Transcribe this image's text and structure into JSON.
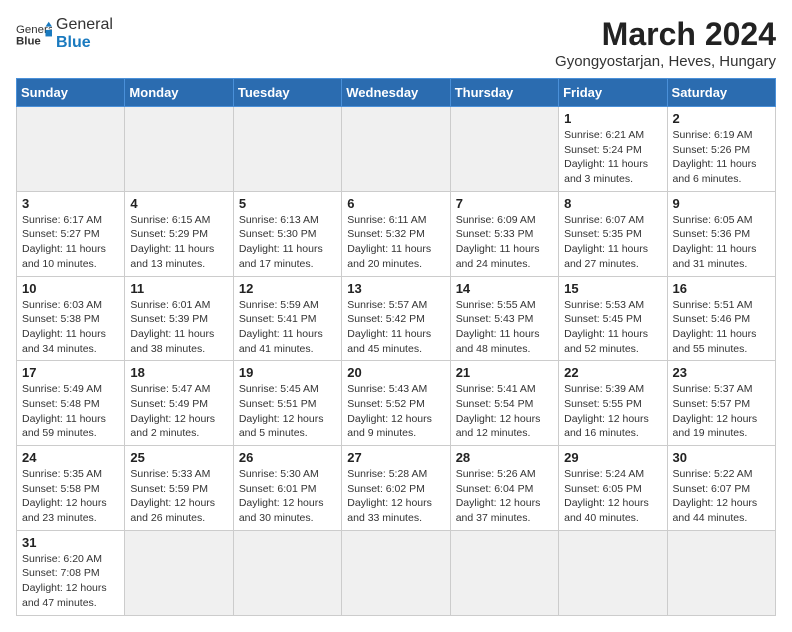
{
  "header": {
    "logo_text_normal": "General",
    "logo_text_bold": "Blue",
    "month_year": "March 2024",
    "location": "Gyongyostarjan, Heves, Hungary"
  },
  "weekdays": [
    "Sunday",
    "Monday",
    "Tuesday",
    "Wednesday",
    "Thursday",
    "Friday",
    "Saturday"
  ],
  "weeks": [
    [
      {
        "day": "",
        "info": "",
        "empty": true
      },
      {
        "day": "",
        "info": "",
        "empty": true
      },
      {
        "day": "",
        "info": "",
        "empty": true
      },
      {
        "day": "",
        "info": "",
        "empty": true
      },
      {
        "day": "",
        "info": "",
        "empty": true
      },
      {
        "day": "1",
        "info": "Sunrise: 6:21 AM\nSunset: 5:24 PM\nDaylight: 11 hours and 3 minutes."
      },
      {
        "day": "2",
        "info": "Sunrise: 6:19 AM\nSunset: 5:26 PM\nDaylight: 11 hours and 6 minutes."
      }
    ],
    [
      {
        "day": "3",
        "info": "Sunrise: 6:17 AM\nSunset: 5:27 PM\nDaylight: 11 hours and 10 minutes."
      },
      {
        "day": "4",
        "info": "Sunrise: 6:15 AM\nSunset: 5:29 PM\nDaylight: 11 hours and 13 minutes."
      },
      {
        "day": "5",
        "info": "Sunrise: 6:13 AM\nSunset: 5:30 PM\nDaylight: 11 hours and 17 minutes."
      },
      {
        "day": "6",
        "info": "Sunrise: 6:11 AM\nSunset: 5:32 PM\nDaylight: 11 hours and 20 minutes."
      },
      {
        "day": "7",
        "info": "Sunrise: 6:09 AM\nSunset: 5:33 PM\nDaylight: 11 hours and 24 minutes."
      },
      {
        "day": "8",
        "info": "Sunrise: 6:07 AM\nSunset: 5:35 PM\nDaylight: 11 hours and 27 minutes."
      },
      {
        "day": "9",
        "info": "Sunrise: 6:05 AM\nSunset: 5:36 PM\nDaylight: 11 hours and 31 minutes."
      }
    ],
    [
      {
        "day": "10",
        "info": "Sunrise: 6:03 AM\nSunset: 5:38 PM\nDaylight: 11 hours and 34 minutes."
      },
      {
        "day": "11",
        "info": "Sunrise: 6:01 AM\nSunset: 5:39 PM\nDaylight: 11 hours and 38 minutes."
      },
      {
        "day": "12",
        "info": "Sunrise: 5:59 AM\nSunset: 5:41 PM\nDaylight: 11 hours and 41 minutes."
      },
      {
        "day": "13",
        "info": "Sunrise: 5:57 AM\nSunset: 5:42 PM\nDaylight: 11 hours and 45 minutes."
      },
      {
        "day": "14",
        "info": "Sunrise: 5:55 AM\nSunset: 5:43 PM\nDaylight: 11 hours and 48 minutes."
      },
      {
        "day": "15",
        "info": "Sunrise: 5:53 AM\nSunset: 5:45 PM\nDaylight: 11 hours and 52 minutes."
      },
      {
        "day": "16",
        "info": "Sunrise: 5:51 AM\nSunset: 5:46 PM\nDaylight: 11 hours and 55 minutes."
      }
    ],
    [
      {
        "day": "17",
        "info": "Sunrise: 5:49 AM\nSunset: 5:48 PM\nDaylight: 11 hours and 59 minutes."
      },
      {
        "day": "18",
        "info": "Sunrise: 5:47 AM\nSunset: 5:49 PM\nDaylight: 12 hours and 2 minutes."
      },
      {
        "day": "19",
        "info": "Sunrise: 5:45 AM\nSunset: 5:51 PM\nDaylight: 12 hours and 5 minutes."
      },
      {
        "day": "20",
        "info": "Sunrise: 5:43 AM\nSunset: 5:52 PM\nDaylight: 12 hours and 9 minutes."
      },
      {
        "day": "21",
        "info": "Sunrise: 5:41 AM\nSunset: 5:54 PM\nDaylight: 12 hours and 12 minutes."
      },
      {
        "day": "22",
        "info": "Sunrise: 5:39 AM\nSunset: 5:55 PM\nDaylight: 12 hours and 16 minutes."
      },
      {
        "day": "23",
        "info": "Sunrise: 5:37 AM\nSunset: 5:57 PM\nDaylight: 12 hours and 19 minutes."
      }
    ],
    [
      {
        "day": "24",
        "info": "Sunrise: 5:35 AM\nSunset: 5:58 PM\nDaylight: 12 hours and 23 minutes."
      },
      {
        "day": "25",
        "info": "Sunrise: 5:33 AM\nSunset: 5:59 PM\nDaylight: 12 hours and 26 minutes."
      },
      {
        "day": "26",
        "info": "Sunrise: 5:30 AM\nSunset: 6:01 PM\nDaylight: 12 hours and 30 minutes."
      },
      {
        "day": "27",
        "info": "Sunrise: 5:28 AM\nSunset: 6:02 PM\nDaylight: 12 hours and 33 minutes."
      },
      {
        "day": "28",
        "info": "Sunrise: 5:26 AM\nSunset: 6:04 PM\nDaylight: 12 hours and 37 minutes."
      },
      {
        "day": "29",
        "info": "Sunrise: 5:24 AM\nSunset: 6:05 PM\nDaylight: 12 hours and 40 minutes."
      },
      {
        "day": "30",
        "info": "Sunrise: 5:22 AM\nSunset: 6:07 PM\nDaylight: 12 hours and 44 minutes."
      }
    ],
    [
      {
        "day": "31",
        "info": "Sunrise: 6:20 AM\nSunset: 7:08 PM\nDaylight: 12 hours and 47 minutes.",
        "has_data": true
      },
      {
        "day": "",
        "info": "",
        "empty": true
      },
      {
        "day": "",
        "info": "",
        "empty": true
      },
      {
        "day": "",
        "info": "",
        "empty": true
      },
      {
        "day": "",
        "info": "",
        "empty": true
      },
      {
        "day": "",
        "info": "",
        "empty": true
      },
      {
        "day": "",
        "info": "",
        "empty": true
      }
    ]
  ]
}
